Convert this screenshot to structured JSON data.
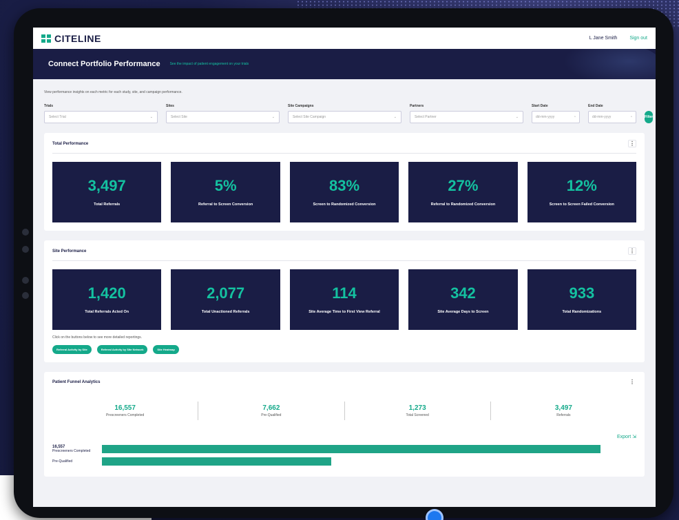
{
  "app": {
    "logo": "CITELINE",
    "user_name": "L Jane Smith",
    "sign_out": "Sign out"
  },
  "banner": {
    "title": "Connect Portfolio Performance",
    "subtitle": "See the impact of patient engagement on your trials"
  },
  "intro": "View performance insights on each metric for each study, site, and campaign performance.",
  "filters": {
    "trials": {
      "label": "Trials",
      "placeholder": "Select Trial"
    },
    "sites": {
      "label": "Sites",
      "placeholder": "Select Site"
    },
    "campaigns": {
      "label": "Site Campaigns",
      "placeholder": "Select Site Campaign"
    },
    "partners": {
      "label": "Partners",
      "placeholder": "Select Partner"
    },
    "start": {
      "label": "Start Date",
      "placeholder": "dd-mm-yyyy"
    },
    "end": {
      "label": "End Date",
      "placeholder": "dd-mm-yyyy"
    },
    "button": "Filter"
  },
  "total_performance": {
    "title": "Total Performance",
    "cards": [
      {
        "value": "3,497",
        "label": "Total Referrals"
      },
      {
        "value": "5%",
        "label": "Referral to Screen Conversion"
      },
      {
        "value": "83%",
        "label": "Screen to Randomized Conversion"
      },
      {
        "value": "27%",
        "label": "Referral to Randomized Conversion"
      },
      {
        "value": "12%",
        "label": "Screen to Screen Failed Conversion"
      }
    ]
  },
  "site_performance": {
    "title": "Site Performance",
    "cards": [
      {
        "value": "1,420",
        "label": "Total Referrals Acted On"
      },
      {
        "value": "2,077",
        "label": "Total Unactioned Referrals"
      },
      {
        "value": "114",
        "label": "Site Average Time to First View Referral"
      },
      {
        "value": "342",
        "label": "Site Average Days to Screen"
      },
      {
        "value": "933",
        "label": "Total Randomizations"
      }
    ],
    "note": "Click on the buttons below to see more detailed reportings.",
    "pills": [
      "Referral Activity by Site",
      "Referral Activity by Site Network",
      "Site Heatmap"
    ]
  },
  "funnel": {
    "title": "Patient Funnel Analytics",
    "stats": [
      {
        "value": "16,557",
        "label": "Prescreeners Completed"
      },
      {
        "value": "7,662",
        "label": "Pre-Qualified"
      },
      {
        "value": "1,273",
        "label": "Total Screened"
      },
      {
        "value": "3,497",
        "label": "Referrals"
      }
    ],
    "export": "Export",
    "bars": [
      {
        "value": "16,557",
        "label": "Prescreeners Completed",
        "pct": 100
      },
      {
        "value": "",
        "label": "Pre-Qualified",
        "pct": 46
      }
    ]
  },
  "colors": {
    "navy": "#1a1d45",
    "teal": "#14a98a",
    "accent": "#14c1a0"
  }
}
